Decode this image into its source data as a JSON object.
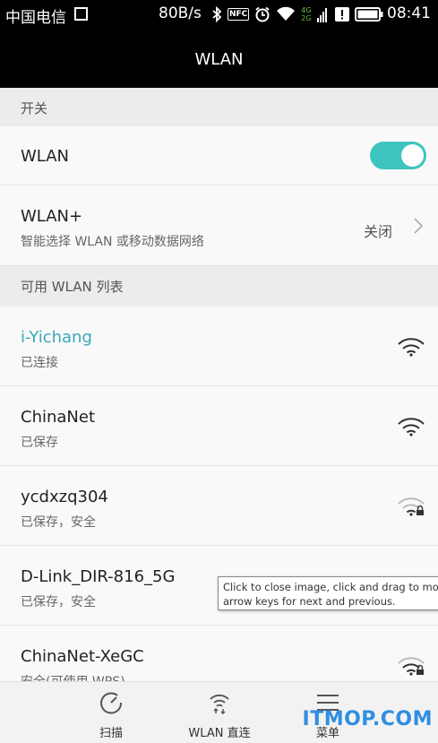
{
  "status_bar": {
    "carrier": "中国电信",
    "speed": "80B/s",
    "nfc_label": "NFC",
    "network_top": "4G",
    "network_bottom": "2G",
    "time": "08:41"
  },
  "title": "WLAN",
  "sections": {
    "switch_header": "开关",
    "available_header": "可用 WLAN 列表"
  },
  "wlan_toggle": {
    "label": "WLAN",
    "state": "on"
  },
  "wlan_plus": {
    "label": "WLAN+",
    "description": "智能选择 WLAN 或移动数据网络",
    "value": "关闭"
  },
  "networks": [
    {
      "ssid": "i-Yichang",
      "status": "已连接",
      "locked": false
    },
    {
      "ssid": "ChinaNet",
      "status": "已保存",
      "locked": false
    },
    {
      "ssid": "ycdxzq304",
      "status": "已保存，安全",
      "locked": true
    },
    {
      "ssid": "D-Link_DIR-816_5G",
      "status": "已保存，安全",
      "locked": true
    },
    {
      "ssid": "ChinaNet-XeGC",
      "status": "安全(可使用 WPS)",
      "locked": true
    }
  ],
  "tooltip": {
    "line1": "Click to close image, click and drag to move. Use",
    "line2": "arrow keys for next and previous."
  },
  "bottom_bar": {
    "scan": "扫描",
    "direct": "WLAN 直连",
    "menu": "菜单"
  },
  "watermark": "ITMOP.COM",
  "colors": {
    "accent": "#3ec4bf",
    "connected_text": "#3aa9b8",
    "watermark": "#2f8ee0"
  },
  "icons": [
    "sim-icon",
    "bluetooth-icon",
    "nfc-icon",
    "alarm-icon",
    "wifi-signal-icon",
    "cellular-signal-icon",
    "notification-icon",
    "battery-icon",
    "wifi-icon",
    "wifi-lock-icon",
    "chevron-right-icon",
    "scan-icon",
    "wifi-direct-icon",
    "menu-icon"
  ]
}
